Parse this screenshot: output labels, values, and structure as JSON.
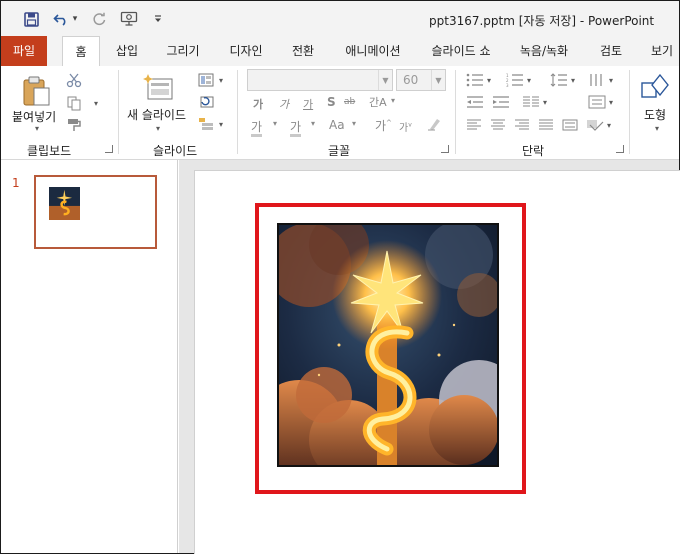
{
  "titlebar": {
    "title": "ppt3167.pptm [자동 저장]  -  PowerPoint",
    "qat": [
      {
        "name": "save-icon",
        "glyph": "💾"
      },
      {
        "name": "undo-icon",
        "glyph": "↶"
      },
      {
        "name": "undo-dropdown-icon",
        "glyph": "▾"
      },
      {
        "name": "redo-icon",
        "glyph": "↻"
      },
      {
        "name": "present-icon",
        "glyph": "⎚"
      },
      {
        "name": "customize-qat-icon",
        "glyph": "⩡"
      }
    ]
  },
  "tabs": [
    {
      "name": "tab-file",
      "label": "파일"
    },
    {
      "name": "tab-home",
      "label": "홈"
    },
    {
      "name": "tab-insert",
      "label": "삽입"
    },
    {
      "name": "tab-draw",
      "label": "그리기"
    },
    {
      "name": "tab-design",
      "label": "디자인"
    },
    {
      "name": "tab-transitions",
      "label": "전환"
    },
    {
      "name": "tab-animations",
      "label": "애니메이션"
    },
    {
      "name": "tab-slideshow",
      "label": "슬라이드 쇼"
    },
    {
      "name": "tab-record",
      "label": "녹음/녹화"
    },
    {
      "name": "tab-review",
      "label": "검토"
    },
    {
      "name": "tab-view",
      "label": "보기"
    }
  ],
  "ribbon": {
    "clipboard": {
      "paste_label": "붙여넣기",
      "group_label": "클립보드"
    },
    "slides": {
      "new_slide_label": "새 슬라이드",
      "group_label": "슬라이드"
    },
    "font": {
      "font_name": "",
      "font_size": "60",
      "buttons": [
        "가",
        "가",
        "S",
        "ab",
        "간A"
      ],
      "group_label": "글꼴"
    },
    "paragraph": {
      "group_label": "단락"
    },
    "drawing": {
      "shape_label": "도형"
    }
  },
  "thumbnails": [
    {
      "number": "1"
    }
  ],
  "colors": {
    "file_tab": "#c43e1c",
    "highlight": "#e0161b",
    "thumb_border": "#b85a3a"
  }
}
